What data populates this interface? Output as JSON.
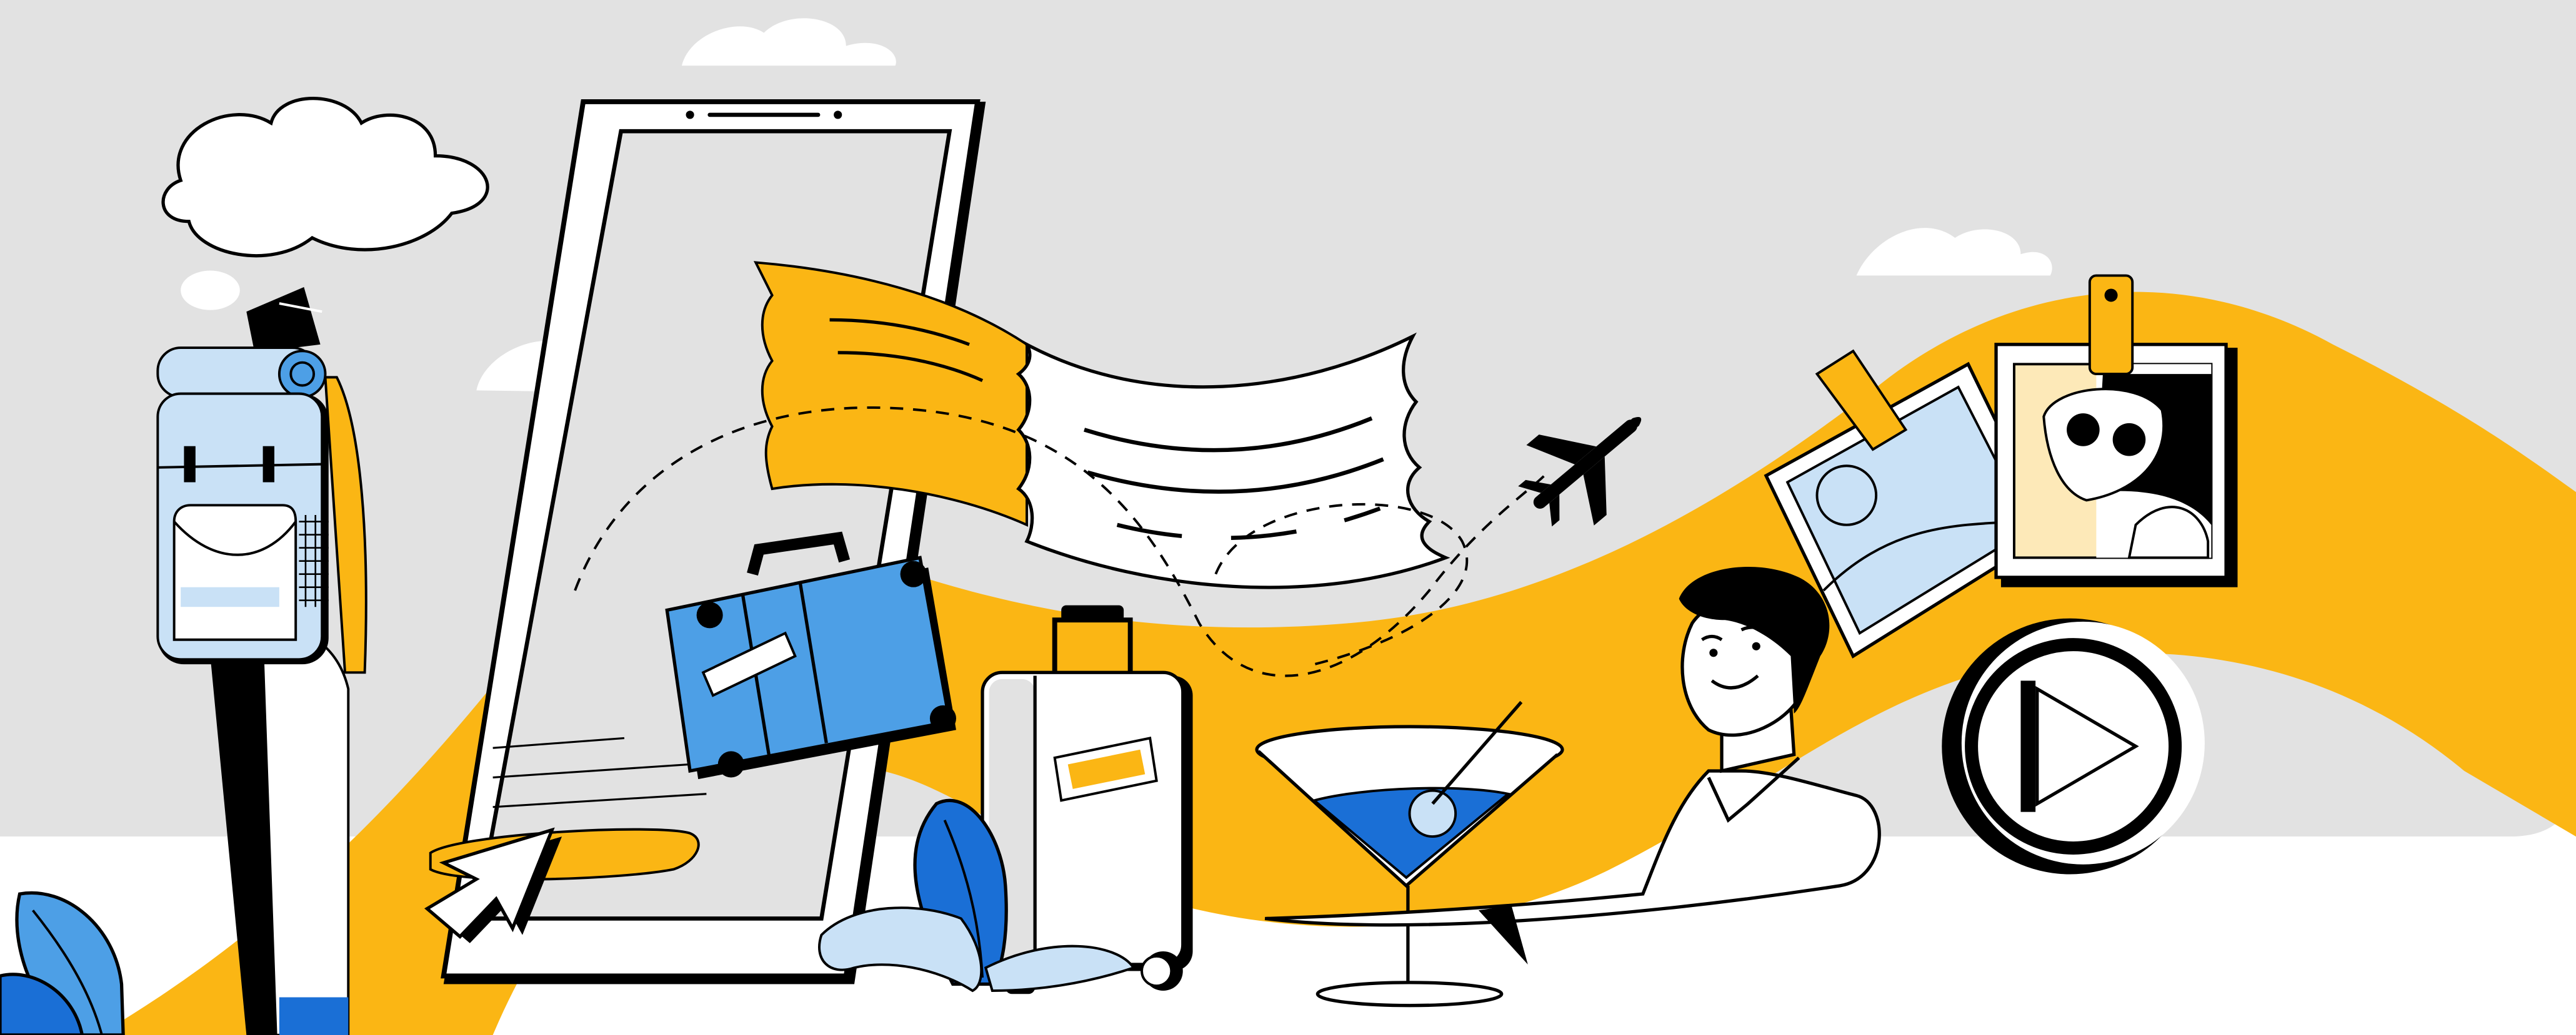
{
  "scene": {
    "description_free": true,
    "colors": {
      "background_gray": "#e2e2e2",
      "accent_yellow": "#fbb614",
      "blue": "#4d9fe6",
      "light_blue": "#c9e1f6",
      "dark_blue": "#1a6fd6",
      "cream": "#fde9b8",
      "outline": "#000000",
      "white": "#ffffff"
    },
    "icons": [
      "cloud-icon",
      "smartphone-icon",
      "ticket-icon",
      "airplane-icon",
      "suitcase-icon",
      "luggage-icon",
      "cocktail-glass-icon",
      "photo-icon",
      "play-button-icon",
      "cursor-arrow-icon",
      "backpack-icon",
      "leaf-icon"
    ]
  }
}
